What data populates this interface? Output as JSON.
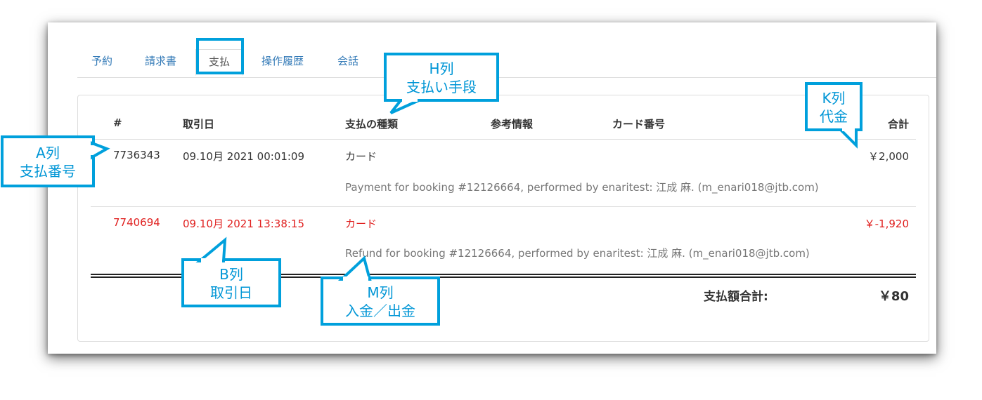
{
  "tabs": [
    "予約",
    "請求書",
    "支払",
    "操作履歴",
    "会話"
  ],
  "active_tab": "支払",
  "table": {
    "headers": {
      "num": "#",
      "date": "取引日",
      "type": "支払の種類",
      "ref": "参考情報",
      "card": "カード番号",
      "total": "合計"
    },
    "rows": [
      {
        "id": "7736343",
        "date": "09.10月 2021 00:01:09",
        "type": "カード",
        "amount": "￥2,000",
        "description": "Payment for booking #12126664, performed by enaritest: 江成 麻. (m_enari018@jtb.com)",
        "negative": false
      },
      {
        "id": "7740694",
        "date": "09.10月 2021 13:38:15",
        "type": "カード",
        "amount": "￥-1,920",
        "description": "Refund for booking #12126664, performed by enaritest: 江成 麻. (m_enari018@jtb.com)",
        "negative": true
      }
    ],
    "total_label": "支払額合計:",
    "total_value": "￥80"
  },
  "annotations": {
    "a": [
      "A列",
      "支払番号"
    ],
    "b": [
      "B列",
      "取引日"
    ],
    "h": [
      "H列",
      "支払い手段"
    ],
    "k": [
      "K列",
      "代金"
    ],
    "m": [
      "M列",
      "入金／出金"
    ]
  },
  "colors": {
    "accent": "#00a0dc",
    "link": "#337ab7",
    "negative": "#e0201f"
  }
}
